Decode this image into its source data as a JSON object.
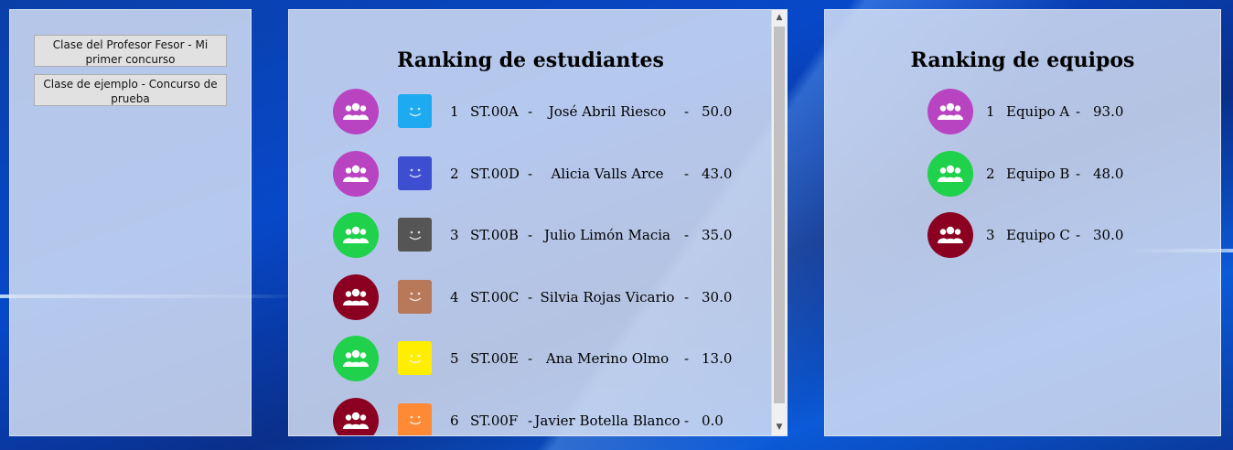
{
  "classes": [
    {
      "label": "Clase del Profesor Fesor - Mi primer concurso"
    },
    {
      "label": "Clase de ejemplo - Concurso de prueba"
    }
  ],
  "students_ranking": {
    "title": "Ranking de estudiantes",
    "rows": [
      {
        "rank": "1",
        "code": "ST.00A",
        "sep": "-",
        "name": "José Abril Riesco",
        "sep2": "-",
        "score": "50.0",
        "team_color": "#b944c1",
        "avatar_color": "#1eaaf1"
      },
      {
        "rank": "2",
        "code": "ST.00D",
        "sep": "-",
        "name": "Alicia Valls Arce",
        "sep2": "-",
        "score": "43.0",
        "team_color": "#b944c1",
        "avatar_color": "#3d4fd0"
      },
      {
        "rank": "3",
        "code": "ST.00B",
        "sep": "-",
        "name": "Julio Limón Macia",
        "sep2": "-",
        "score": "35.0",
        "team_color": "#1fd14b",
        "avatar_color": "#555555"
      },
      {
        "rank": "4",
        "code": "ST.00C",
        "sep": "-",
        "name": "Silvia Rojas Vicario",
        "sep2": "-",
        "score": "30.0",
        "team_color": "#8b0020",
        "avatar_color": "#b8785a"
      },
      {
        "rank": "5",
        "code": "ST.00E",
        "sep": "-",
        "name": "Ana Merino Olmo",
        "sep2": "-",
        "score": "13.0",
        "team_color": "#1fd14b",
        "avatar_color": "#ffee00"
      },
      {
        "rank": "6",
        "code": "ST.00F",
        "sep": "-",
        "name": "Javier Botella Blanco",
        "sep2": "-",
        "score": "0.0",
        "team_color": "#8b0020",
        "avatar_color": "#ff8a35"
      }
    ]
  },
  "teams_ranking": {
    "title": "Ranking de equipos",
    "rows": [
      {
        "rank": "1",
        "name": "Equipo A",
        "sep": "-",
        "score": "93.0",
        "team_color": "#b944c1"
      },
      {
        "rank": "2",
        "name": "Equipo B",
        "sep": "-",
        "score": "48.0",
        "team_color": "#1fd14b"
      },
      {
        "rank": "3",
        "name": "Equipo C",
        "sep": "-",
        "score": "30.0",
        "team_color": "#8b0020"
      }
    ]
  },
  "icons": {
    "team": "group-icon",
    "avatar": "smiley-face-icon"
  }
}
